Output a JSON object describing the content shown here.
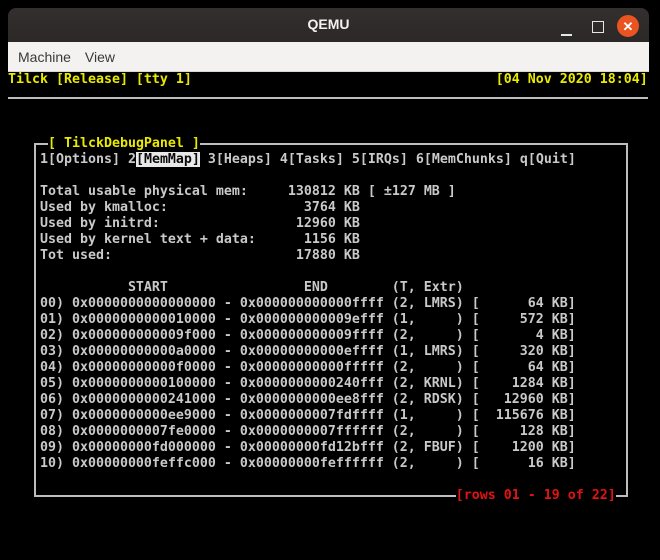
{
  "window": {
    "title": "QEMU",
    "controls": {
      "minimize": "minimize",
      "maximize": "maximize",
      "close": "close"
    }
  },
  "menubar": {
    "items": [
      {
        "label": "Machine"
      },
      {
        "label": "View"
      }
    ]
  },
  "colors": {
    "close_button": "#E95420",
    "titlebar_bg": "#2d2a29",
    "menubar_bg": "#f3f2f0",
    "terminal_fg": "#c9c9c9",
    "terminal_yellow": "#eaea00",
    "terminal_red": "#e31212",
    "tab_highlight_bg": "#e8e8e8"
  },
  "console": {
    "status_left": "Tilck [Release] [tty 1]",
    "status_right": "[04 Nov 2020 18:04]",
    "panel": {
      "title": "[ TilckDebugPanel ]",
      "tabs": [
        {
          "key": "1",
          "label": "[Options]",
          "active": false
        },
        {
          "key": "2",
          "label": "[MemMap]",
          "active": true
        },
        {
          "key": "3",
          "label": "[Heaps]",
          "active": false
        },
        {
          "key": "4",
          "label": "[Tasks]",
          "active": false
        },
        {
          "key": "5",
          "label": "[IRQs]",
          "active": false
        },
        {
          "key": "6",
          "label": "[MemChunks]",
          "active": false
        },
        {
          "key": "q",
          "label": "[Quit]",
          "active": false
        }
      ],
      "mem_stats": [
        {
          "label": "Total usable physical mem:",
          "value": "130812",
          "unit": "KB",
          "extra": "[ ±127 MB ]"
        },
        {
          "label": "Used by kmalloc:",
          "value": "3764",
          "unit": "KB",
          "extra": ""
        },
        {
          "label": "Used by initrd:",
          "value": "12960",
          "unit": "KB",
          "extra": ""
        },
        {
          "label": "Used by kernel text + data:",
          "value": "1156",
          "unit": "KB",
          "extra": ""
        },
        {
          "label": "Tot used:",
          "value": "17880",
          "unit": "KB",
          "extra": ""
        }
      ],
      "table": {
        "headers": [
          "START",
          "END",
          "(T, Extr)"
        ],
        "rows": [
          {
            "idx": "00",
            "start": "0x0000000000000000",
            "end": "0x000000000000ffff",
            "type": "2",
            "extr": "LMRS",
            "size_kb": "64"
          },
          {
            "idx": "01",
            "start": "0x0000000000010000",
            "end": "0x000000000009efff",
            "type": "1",
            "extr": "",
            "size_kb": "572"
          },
          {
            "idx": "02",
            "start": "0x000000000009f000",
            "end": "0x000000000009ffff",
            "type": "2",
            "extr": "",
            "size_kb": "4"
          },
          {
            "idx": "03",
            "start": "0x00000000000a0000",
            "end": "0x00000000000effff",
            "type": "1",
            "extr": "LMRS",
            "size_kb": "320"
          },
          {
            "idx": "04",
            "start": "0x00000000000f0000",
            "end": "0x00000000000fffff",
            "type": "2",
            "extr": "",
            "size_kb": "64"
          },
          {
            "idx": "05",
            "start": "0x0000000000100000",
            "end": "0x0000000000240fff",
            "type": "2",
            "extr": "KRNL",
            "size_kb": "1284"
          },
          {
            "idx": "06",
            "start": "0x0000000000241000",
            "end": "0x0000000000ee8fff",
            "type": "2",
            "extr": "RDSK",
            "size_kb": "12960"
          },
          {
            "idx": "07",
            "start": "0x0000000000ee9000",
            "end": "0x0000000007fdffff",
            "type": "1",
            "extr": "",
            "size_kb": "115676"
          },
          {
            "idx": "08",
            "start": "0x0000000007fe0000",
            "end": "0x0000000007ffffff",
            "type": "2",
            "extr": "",
            "size_kb": "128"
          },
          {
            "idx": "09",
            "start": "0x00000000fd000000",
            "end": "0x00000000fd12bfff",
            "type": "2",
            "extr": "FBUF",
            "size_kb": "1200"
          },
          {
            "idx": "10",
            "start": "0x00000000feffc000",
            "end": "0x00000000feffffff",
            "type": "2",
            "extr": "",
            "size_kb": "16"
          }
        ]
      },
      "status": "[rows 01 - 19 of 22]"
    }
  }
}
